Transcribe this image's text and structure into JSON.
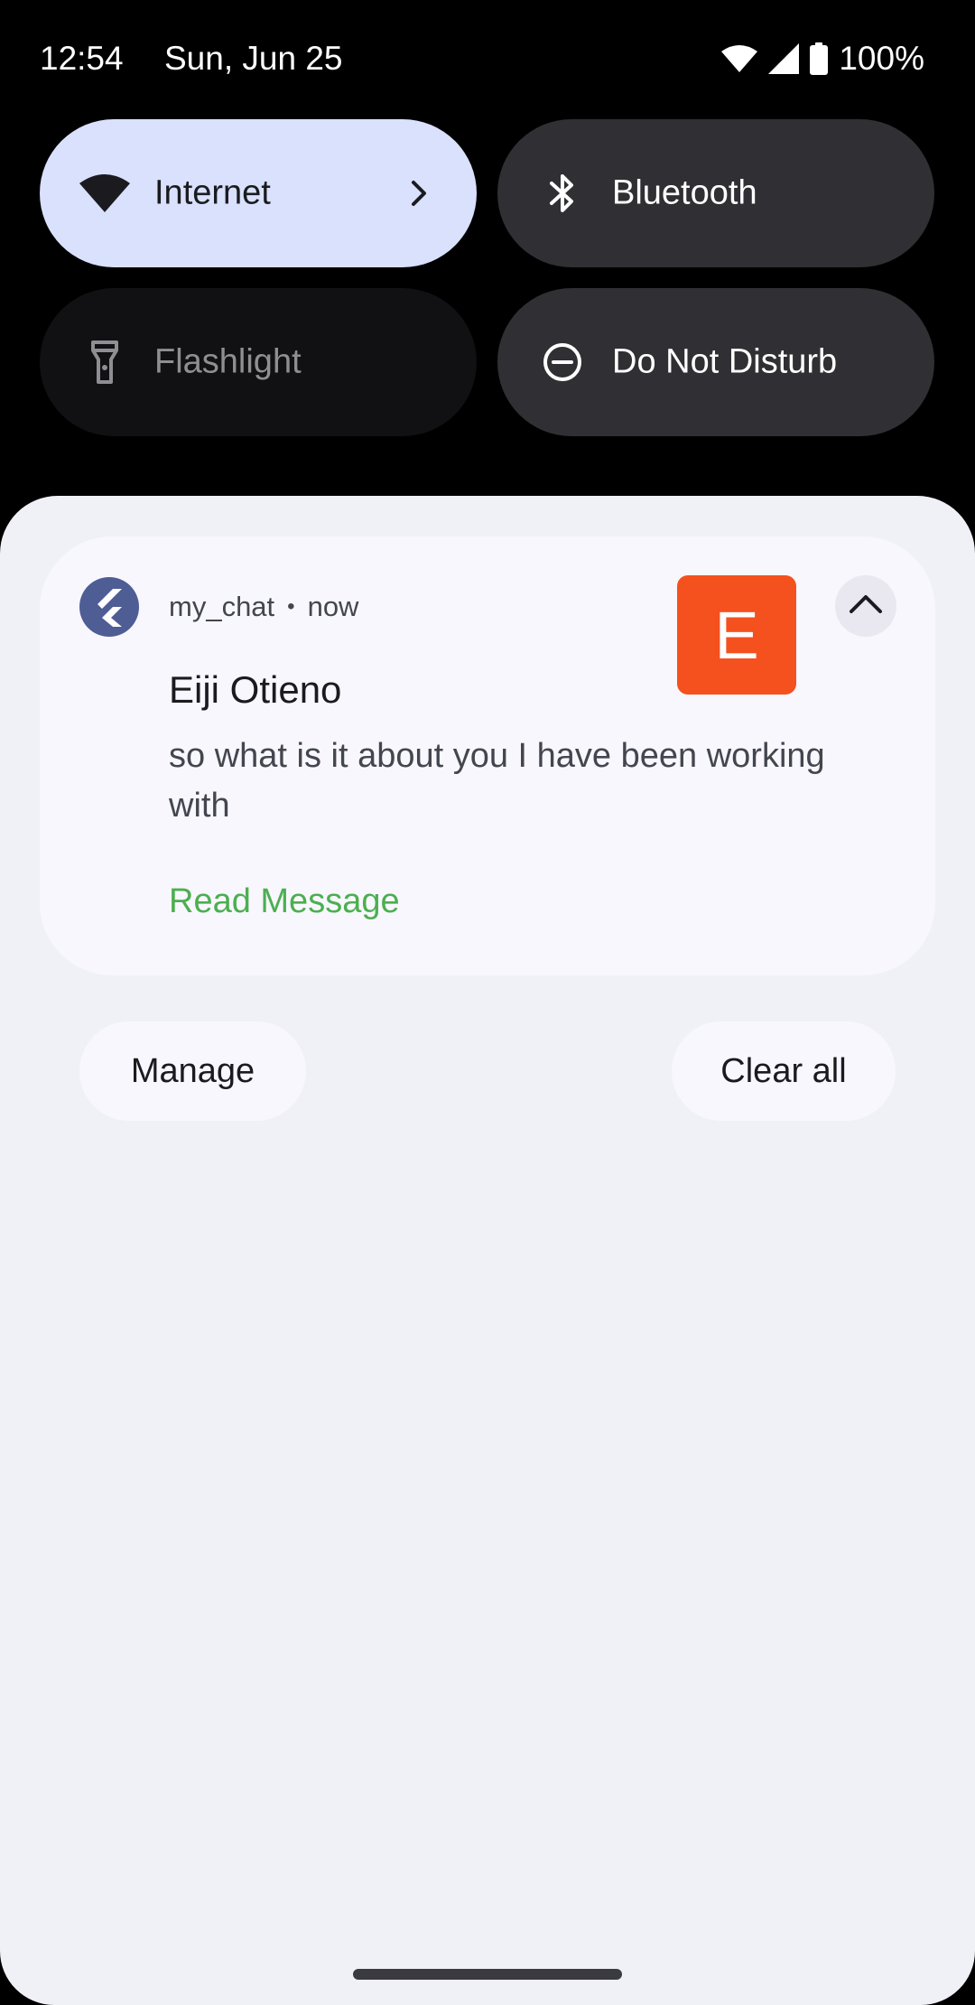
{
  "status_bar": {
    "time": "12:54",
    "date": "Sun, Jun 25",
    "battery": "100%",
    "icons": [
      "wifi-icon",
      "cell-signal-icon",
      "battery-icon"
    ]
  },
  "quick_settings": {
    "tiles": [
      {
        "label": "Internet",
        "icon": "wifi-icon",
        "state": "active",
        "color": "#d9e1fd"
      },
      {
        "label": "Bluetooth",
        "icon": "bluetooth-icon",
        "state": "inactive",
        "color": "#303034"
      },
      {
        "label": "Flashlight",
        "icon": "flashlight-icon",
        "state": "unavailable",
        "color": "#111114"
      },
      {
        "label": "Do Not Disturb",
        "icon": "do-not-disturb-icon",
        "state": "inactive",
        "color": "#303034"
      }
    ]
  },
  "notification": {
    "app_icon": "flutter-icon",
    "app_name": "my_chat",
    "separator": "•",
    "time": "now",
    "avatar_letter": "E",
    "avatar_color": "#f4511e",
    "title": "Eiji Otieno",
    "body": "so what is it about you I have been working with",
    "action": "Read Message",
    "action_color": "#4caf50"
  },
  "buttons": {
    "manage": "Manage",
    "clear_all": "Clear all"
  }
}
